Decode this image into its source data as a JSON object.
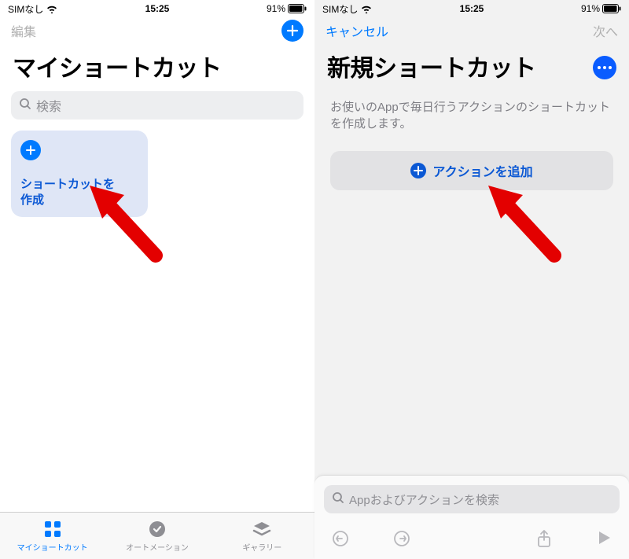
{
  "status": {
    "carrier": "SIMなし",
    "time": "15:25",
    "battery_pct": "91%"
  },
  "left": {
    "nav": {
      "edit": "編集"
    },
    "title": "マイショートカット",
    "search_placeholder": "検索",
    "card": {
      "label": "ショートカットを\n作成"
    },
    "tabs": [
      {
        "label": "マイショートカット"
      },
      {
        "label": "オートメーション"
      },
      {
        "label": "ギャラリー"
      }
    ]
  },
  "right": {
    "nav": {
      "cancel": "キャンセル",
      "next": "次へ"
    },
    "title": "新規ショートカット",
    "description": "お使いのAppで毎日行うアクションのショートカットを作成します。",
    "add_action": "アクションを追加",
    "sheet_search_placeholder": "Appおよびアクションを検索"
  }
}
